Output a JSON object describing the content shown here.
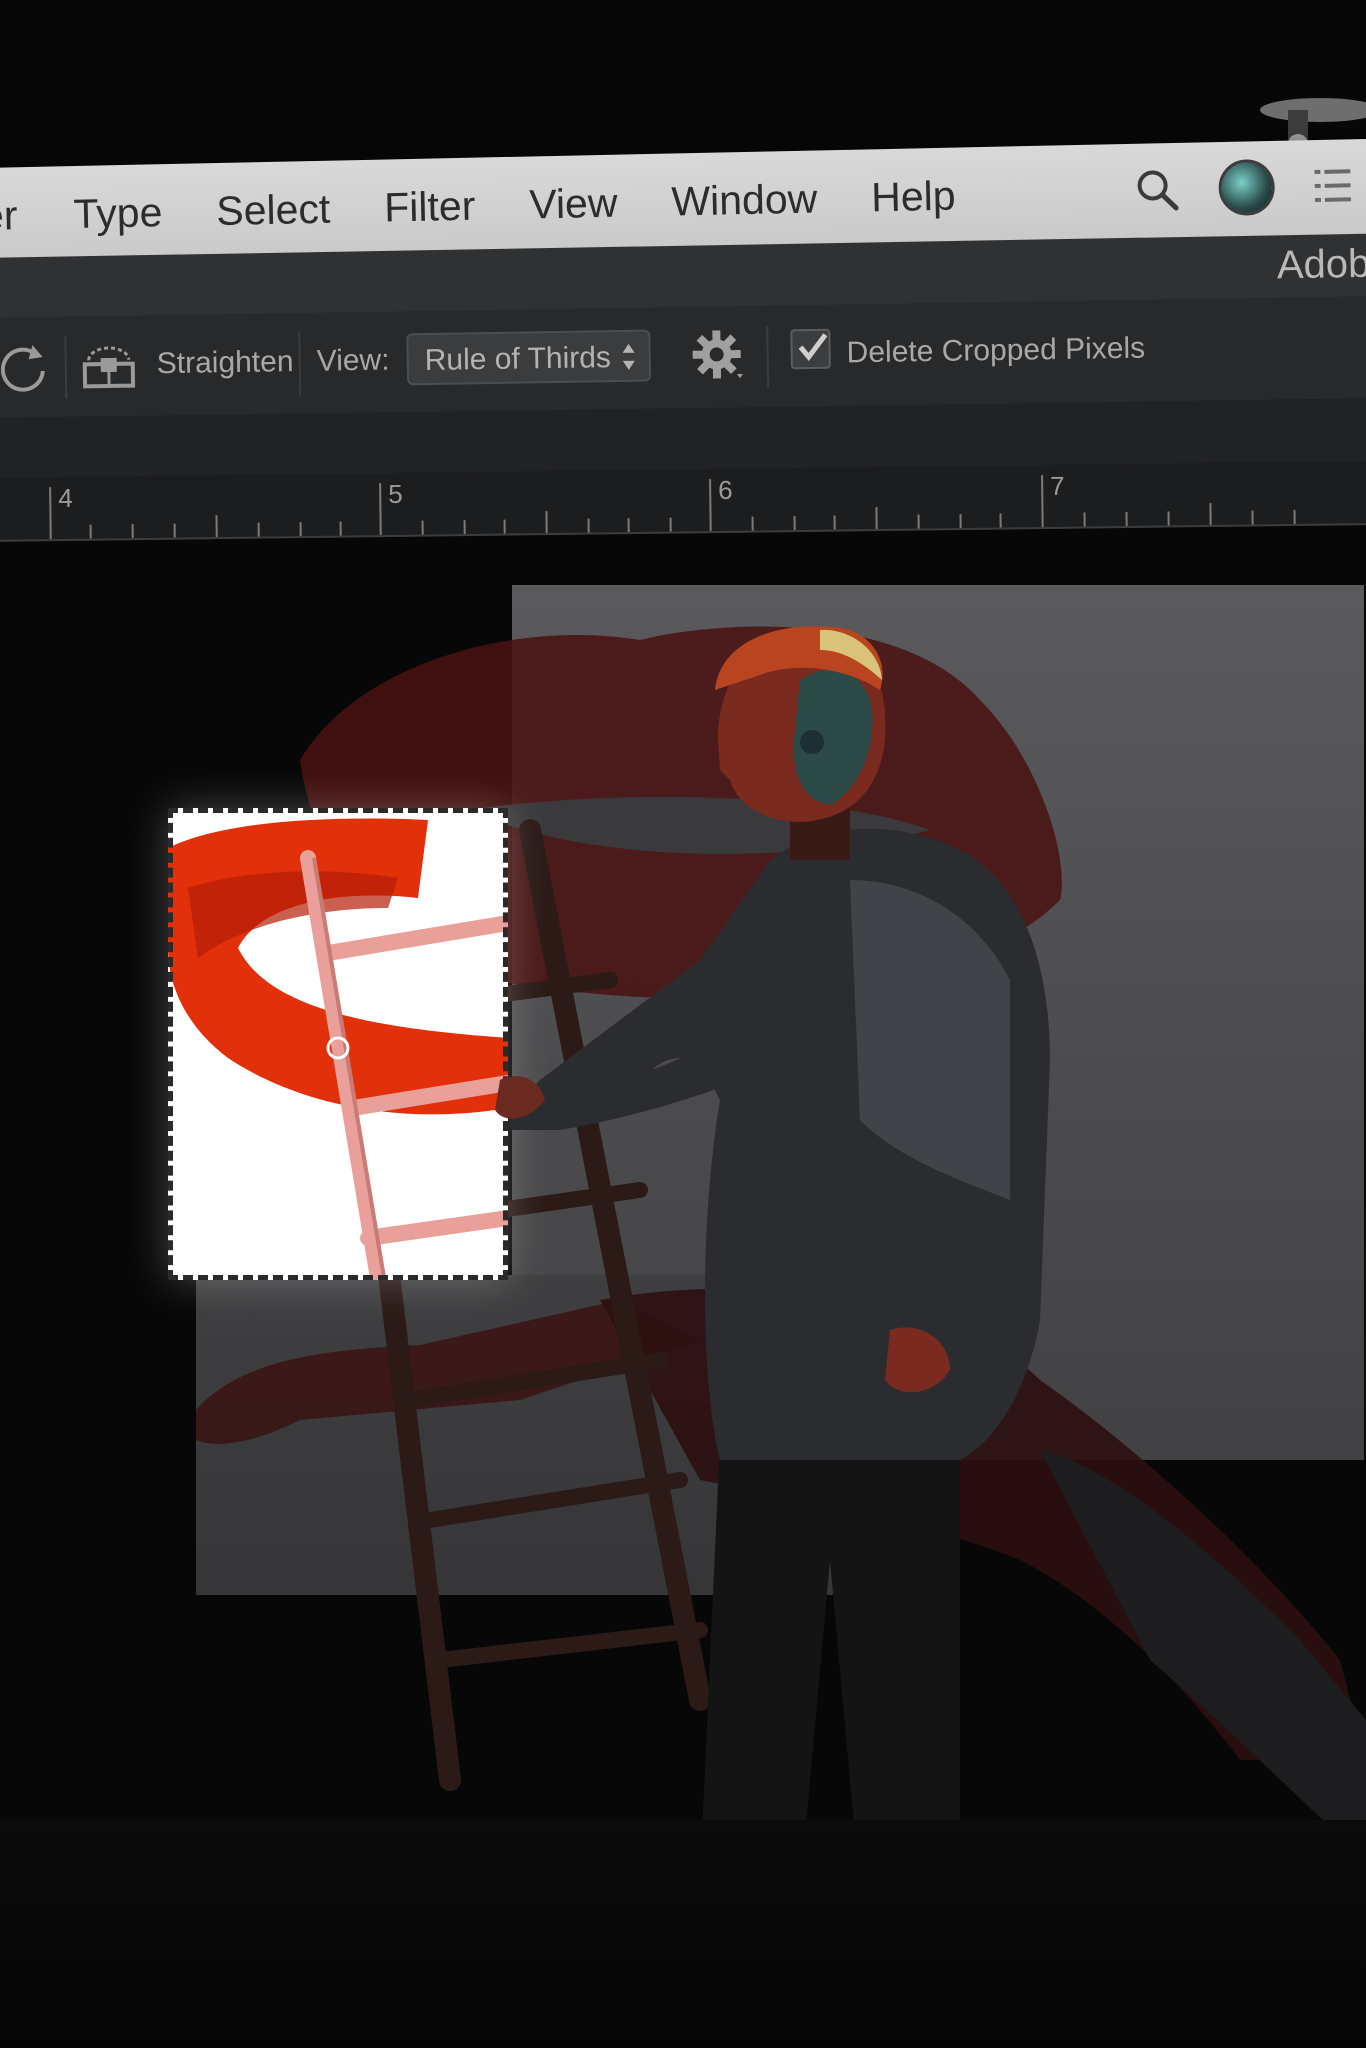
{
  "menubar": {
    "items": [
      "er",
      "Type",
      "Select",
      "Filter",
      "View",
      "Window",
      "Help"
    ],
    "icons": [
      "search-icon",
      "globe-icon",
      "list-icon"
    ]
  },
  "titlebar": {
    "app_name": "Adob"
  },
  "options_bar": {
    "straighten_label": "Straighten",
    "view_label": "View:",
    "view_value": "Rule of Thirds",
    "delete_cropped_label": "Delete Cropped Pixels",
    "delete_cropped_checked": true,
    "icons": [
      "rotate-icon",
      "straighten-icon",
      "gear-icon",
      "checkmark-icon"
    ]
  },
  "ruler": {
    "labels": [
      "4",
      "5",
      "6",
      "7"
    ]
  },
  "colors": {
    "menubar": "#d0d0d0",
    "panel": "#27292b",
    "lips_red": "#e2300a",
    "ladder_pink": "#e9a09a",
    "canvas_gray": "#555557"
  }
}
